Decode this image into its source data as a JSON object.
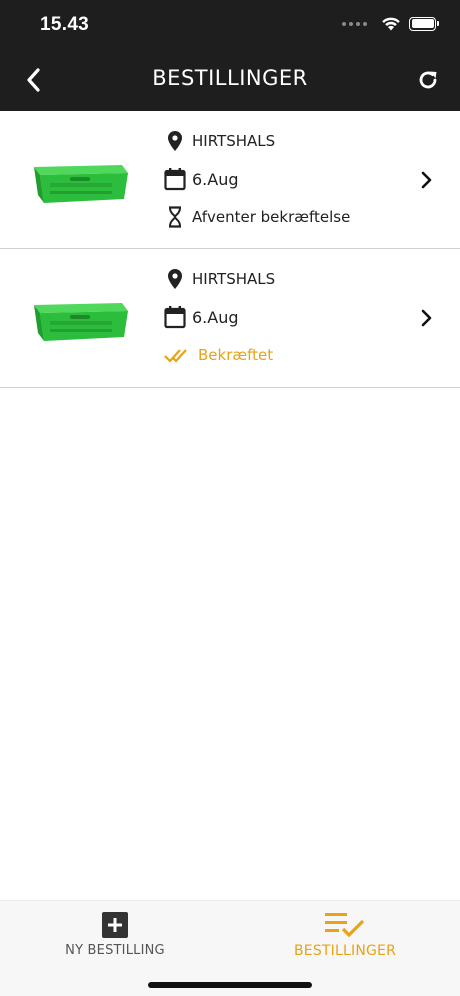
{
  "status_bar": {
    "time": "15.43"
  },
  "header": {
    "title": "BESTILLINGER"
  },
  "orders": [
    {
      "location": "HIRTSHALS",
      "date": "6.Aug",
      "status": "Afventer bekræftelse",
      "status_type": "pending"
    },
    {
      "location": "HIRTSHALS",
      "date": "6.Aug",
      "status": "Bekræftet",
      "status_type": "confirmed"
    }
  ],
  "tabbar": {
    "new_order_label": "NY BESTILLING",
    "orders_label": "BESTILLINGER",
    "active": "orders"
  },
  "colors": {
    "header_bg": "#1e1e1e",
    "accent": "#e8a317",
    "crate_green": "#2bbd3b"
  },
  "icons": {
    "back": "chevron-left-icon",
    "refresh": "refresh-icon",
    "location": "location-pin-icon",
    "date": "calendar-icon",
    "pending": "hourglass-icon",
    "confirmed": "double-check-icon",
    "row_nav": "chevron-right-icon",
    "new_order": "plus-square-icon",
    "orders_list": "list-check-icon"
  }
}
